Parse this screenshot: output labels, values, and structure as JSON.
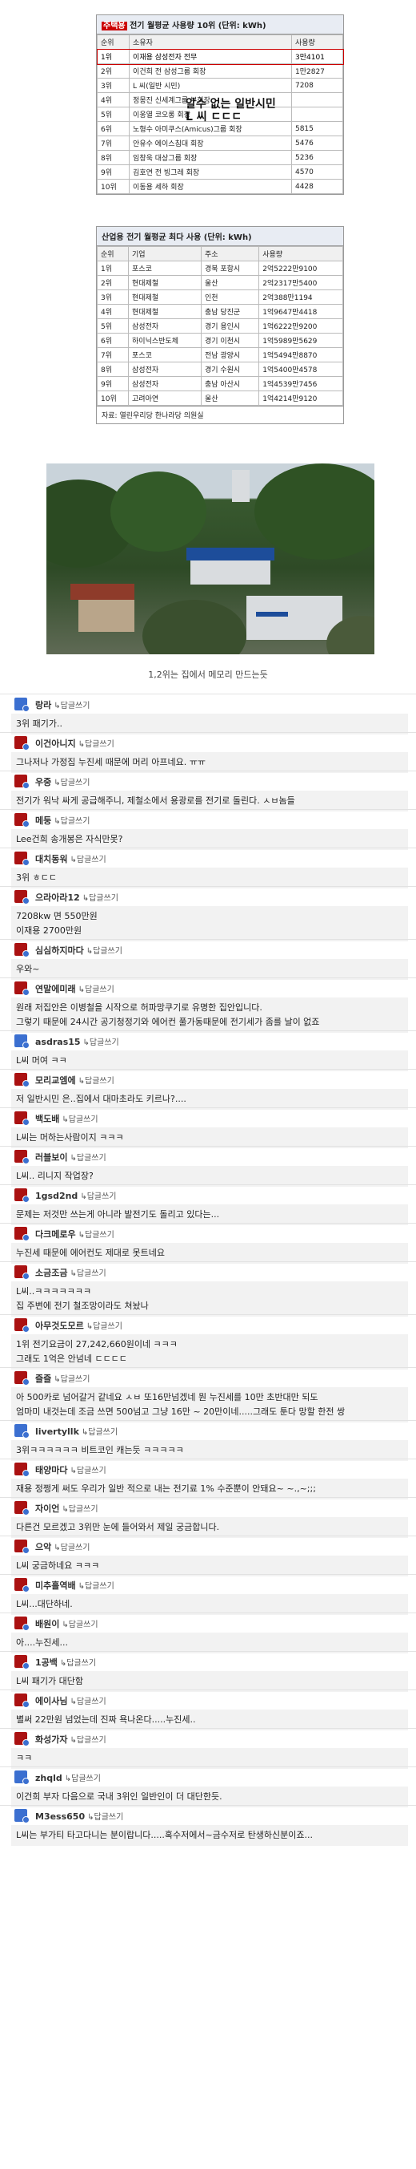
{
  "table1": {
    "badge": "주택용",
    "title_rest": "전기 월평균 사용량 10위 (단위: kWh)",
    "headers": [
      "순위",
      "소유자",
      "사용량"
    ],
    "rows": [
      [
        "1위",
        "이재용 삼성전자 전무",
        "3만4101"
      ],
      [
        "2위",
        "이건희 전 삼성그룹 회장",
        "1만2827"
      ],
      [
        "3위",
        "L 씨(일반 시민)",
        "7208"
      ],
      [
        "4위",
        "정몽진 신세계그룹 부회장",
        ""
      ],
      [
        "5위",
        "이웅열 코오롱 회장",
        ""
      ],
      [
        "6위",
        "노형수 아미쿠스(Amicus)그룹 회장",
        "5815"
      ],
      [
        "7위",
        "안유수 에이스침대 회장",
        "5476"
      ],
      [
        "8위",
        "임창욱 대상그룹 회장",
        "5236"
      ],
      [
        "9위",
        "김호연 전 빙그레 회장",
        "4570"
      ],
      [
        "10위",
        "이동용 세하 회장",
        "4428"
      ]
    ],
    "overlay_line1": "알수 없는 일반시민",
    "overlay_line2": "L 씨 ㄷㄷㄷ"
  },
  "table2": {
    "title": "산업용 전기 월평균 최다 사용 (단위: kWh)",
    "headers": [
      "순위",
      "기업",
      "주소",
      "사용량"
    ],
    "rows": [
      [
        "1위",
        "포스코",
        "경북 포항시",
        "2억5222만9100"
      ],
      [
        "2위",
        "현대제철",
        "울산",
        "2억2317만5400"
      ],
      [
        "3위",
        "현대제철",
        "인천",
        "2억388만1194"
      ],
      [
        "4위",
        "현대제철",
        "충남 당진군",
        "1억9647만4418"
      ],
      [
        "5위",
        "삼성전자",
        "경기 용인시",
        "1억6222만9200"
      ],
      [
        "6위",
        "하이닉스반도체",
        "경기 이천시",
        "1억5989만5629"
      ],
      [
        "7위",
        "포스코",
        "전남 광양시",
        "1억5494만8870"
      ],
      [
        "8위",
        "삼성전자",
        "경기 수원시",
        "1억5400만4578"
      ],
      [
        "9위",
        "삼성전자",
        "충남 아산시",
        "1억4539만7456"
      ],
      [
        "10위",
        "고려아연",
        "울산",
        "1억4214만9120"
      ]
    ],
    "source": "자료: 열린우리당 한나라당 의원실"
  },
  "caption": "1,2위는 집에서 메모리 만드는듯",
  "reply_label": "↳답글쓰기",
  "comments": [
    {
      "nick": "랑라",
      "text": "3위 패기가..",
      "color": "#3b6fd0"
    },
    {
      "nick": "이건아니지",
      "text": "그나저나 가정집 누진세 때문에 머리 아프네요. ㅠㅠ",
      "color": "#aa1111"
    },
    {
      "nick": "우중",
      "text": "전기가 워낙 싸게 공급해주니, 제철소에서 용광로를 전기로 돌린다. ㅅㅂ놈들",
      "color": "#aa1111"
    },
    {
      "nick": "메둥",
      "text": "Lee건희 송개봉은 자식만못?",
      "color": "#aa1111"
    },
    {
      "nick": "대치동워",
      "text": "3위 ㅎㄷㄷ",
      "color": "#aa1111"
    },
    {
      "nick": "으라아라12",
      "text": "7208kw 면 550만원",
      "text2": "이재용 2700만원",
      "color": "#aa1111"
    },
    {
      "nick": "심심하지마다",
      "text": "우와~",
      "color": "#aa1111"
    },
    {
      "nick": "연말에미래",
      "text": "원래 저집안은 이병철을 시작으로 허파망쿠기로 유명한 집안입니다.",
      "text2": "그렇기 때문에 24시간 공기청정기와 에어컨 풀가동때문에 전기세가 좀를 날이 없죠",
      "color": "#aa1111"
    },
    {
      "nick": "asdras15",
      "text": "L씨 머여 ㅋㅋ",
      "color": "#3b6fd0"
    },
    {
      "nick": "모리교엠에",
      "text": "저 일반시민 은..집에서 대마초라도 키르나?....",
      "color": "#aa1111"
    },
    {
      "nick": "백도배",
      "text": "L씨는 머하는사람이지 ㅋㅋㅋ",
      "color": "#aa1111"
    },
    {
      "nick": "러블보이",
      "text": "L씨.. 리니지 작업장?",
      "color": "#aa1111"
    },
    {
      "nick": "1gsd2nd",
      "text": "문제는 저것만 쓰는게 아니라 발전기도 돌리고 있다는...",
      "color": "#aa1111"
    },
    {
      "nick": "다크메로우",
      "text": "누진세 때문에 에어컨도 제대로 못트네요",
      "color": "#aa1111"
    },
    {
      "nick": "소금조금",
      "text": "L씨..ㅋㅋㅋㅋㅋㅋㅋ",
      "text2": "집 주변에 전기 철조망이라도 쳐놨나",
      "color": "#aa1111"
    },
    {
      "nick": "아무것도모르",
      "text": "1위 전기요금이 27,242,660원이네 ㅋㅋㅋ",
      "text2": "그래도 1억은 안넘네 ㄷㄷㄷㄷ",
      "color": "#aa1111"
    },
    {
      "nick": "즐즐",
      "text": "아 500카로 넘어갈거 같네요 ㅅㅂ 또16만넘겠네 뭔 누진세를 10만 초반대만 되도",
      "text2": "엄마미 내것는데 조금 쓰면 500넘고 그냥 16만 ~ 20만이네.....그래도 툰다 망할 한전 쌍",
      "color": "#aa1111"
    },
    {
      "nick": "livertyllk",
      "text": "3위ㅋㅋㅋㅋㅋㅋ 비트코인 캐는듯 ㅋㅋㅋㅋㅋ",
      "color": "#3b6fd0"
    },
    {
      "nick": "태양마다",
      "text": "재용 정쩡게 써도 우리가 일반 적으로 내는 전기료 1% 수준뿐이 안돼요~ ~.,~;;;",
      "color": "#aa1111"
    },
    {
      "nick": "자이언",
      "text": "다른건 모르겠고 3위만 눈에 들어와서 제일 궁금합니다.",
      "color": "#aa1111"
    },
    {
      "nick": "으악",
      "text": "L씨 궁금하네요 ㅋㅋㅋ",
      "color": "#aa1111"
    },
    {
      "nick": "미추홀역배",
      "text": "L씨...대단하네.",
      "color": "#aa1111"
    },
    {
      "nick": "배원이",
      "text": "아....누진세...",
      "color": "#aa1111"
    },
    {
      "nick": "1공백",
      "text": "L씨 패기가 대단함",
      "color": "#aa1111"
    },
    {
      "nick": "에이사님",
      "text": "별써 22만원 넘었는데 진짜 욕나온다.....누진세..",
      "color": "#aa1111"
    },
    {
      "nick": "화성가자",
      "text": "ㅋㅋ",
      "color": "#aa1111"
    },
    {
      "nick": "zhqld",
      "text": "이건희 부자 다음으로 국내 3위인 일반인이 더 대단한듯.",
      "color": "#3b6fd0"
    },
    {
      "nick": "M3ess650",
      "text": "L씨는 부가티 타고다니는 분이랍니다.....혹수저에서~금수저로 탄생하신분이죠...",
      "color": "#3b6fd0"
    }
  ]
}
